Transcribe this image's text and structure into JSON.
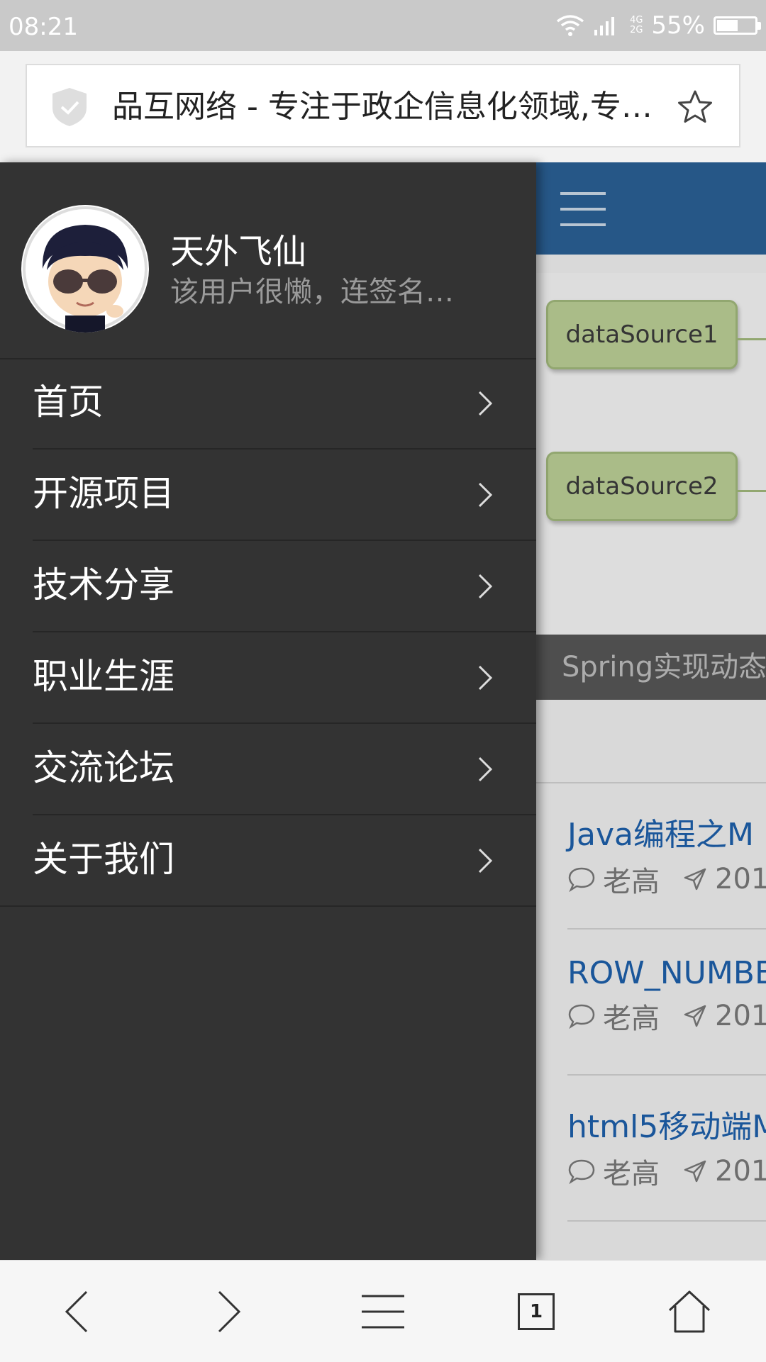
{
  "status": {
    "time": "08:21",
    "network_top": "4G",
    "network_bottom": "2G",
    "battery": "55%",
    "battery_level": 0.55
  },
  "browser": {
    "url_title": "品互网络 - 专注于政企信息化领域,专…",
    "tab_count": "1"
  },
  "drawer": {
    "user_name": "天外飞仙",
    "user_signature": "该用户很懒，连签名…",
    "menu": [
      {
        "label": "首页"
      },
      {
        "label": "开源项目"
      },
      {
        "label": "技术分享"
      },
      {
        "label": "职业生涯"
      },
      {
        "label": "交流论坛"
      },
      {
        "label": "关于我们"
      }
    ]
  },
  "page": {
    "diagram_nodes": [
      "dataSource1",
      "dataSource2"
    ],
    "caption": "Spring实现动态",
    "articles": [
      {
        "title": "Java编程之M",
        "author": "老高",
        "date": "201"
      },
      {
        "title": "ROW_NUMBE",
        "author": "老高",
        "date": "201"
      },
      {
        "title": "html5移动端M",
        "author": "老高",
        "date": "201"
      }
    ]
  },
  "colors": {
    "drawer_bg": "#333333",
    "header_blue": "#2a5f93",
    "link_blue": "#1d5ea8"
  }
}
